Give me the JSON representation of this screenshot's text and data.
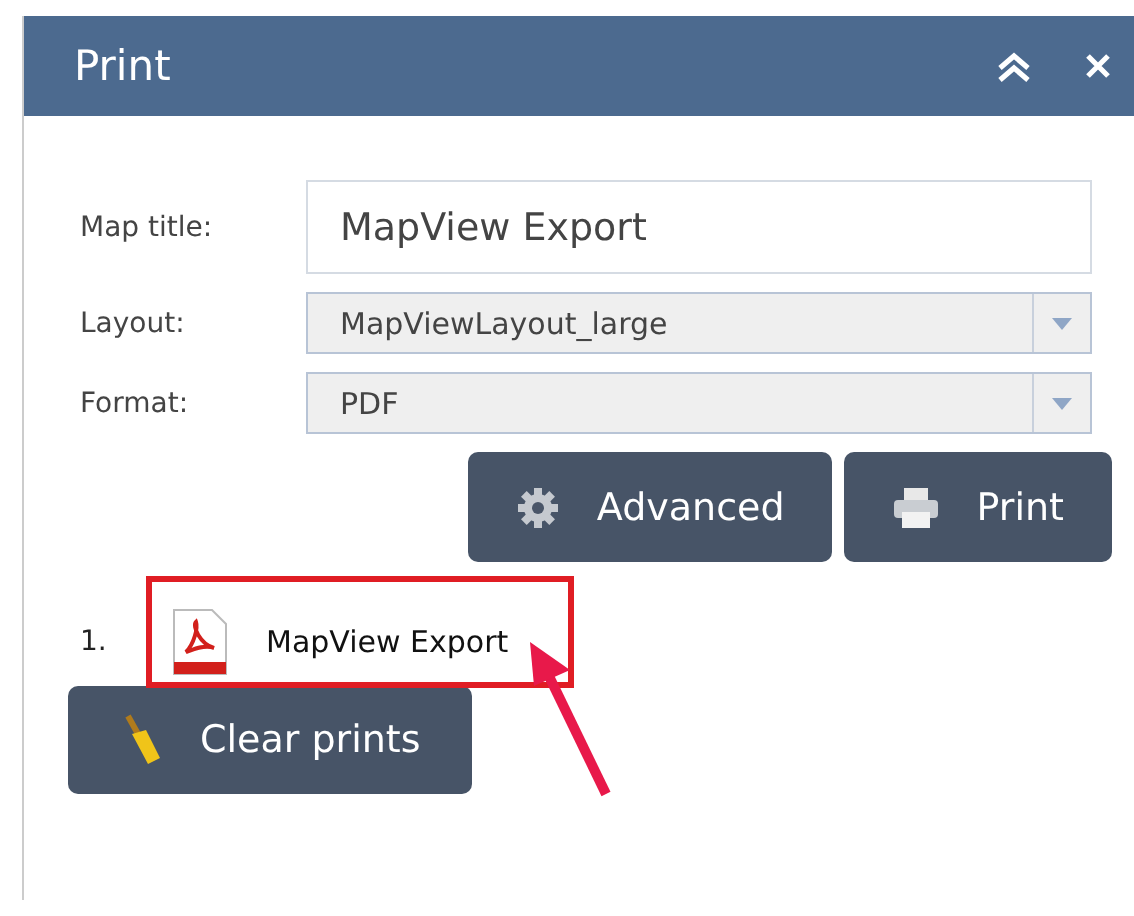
{
  "window": {
    "title": "Print"
  },
  "form": {
    "fields": [
      {
        "kind": "text",
        "label": "Map title:",
        "value": "MapView Export"
      },
      {
        "kind": "select",
        "label": "Layout:",
        "value": "MapViewLayout_large"
      },
      {
        "kind": "select",
        "label": "Format:",
        "value": "PDF"
      }
    ]
  },
  "buttons": [
    {
      "kind": "gear",
      "label": "Advanced"
    },
    {
      "kind": "printer",
      "label": "Print"
    }
  ],
  "prints": [
    {
      "number": "1.",
      "name": "MapView Export",
      "highlighted": true
    }
  ],
  "clear_button": {
    "label": "Clear prints"
  }
}
